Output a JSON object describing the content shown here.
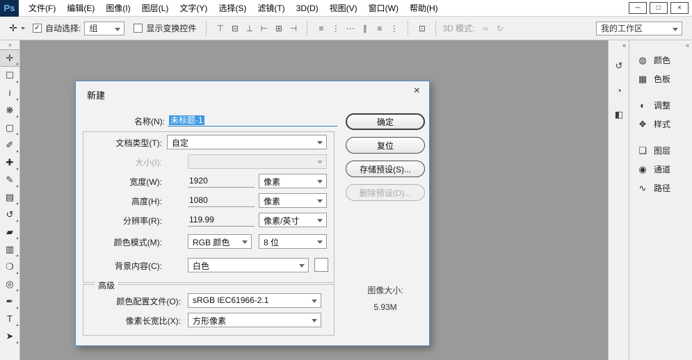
{
  "titlebar": {
    "logo": "Ps",
    "menus": [
      "文件(F)",
      "编辑(E)",
      "图像(I)",
      "图层(L)",
      "文字(Y)",
      "选择(S)",
      "滤镜(T)",
      "3D(D)",
      "视图(V)",
      "窗口(W)",
      "帮助(H)"
    ],
    "controls": {
      "minimize": "─",
      "maximize": "□",
      "close": "×"
    }
  },
  "options_bar": {
    "tool_icon": "✛",
    "auto_select": {
      "label": "自动选择:",
      "value": "组",
      "check_glyph": "✓"
    },
    "show_transform": {
      "label": "显示变换控件",
      "check_glyph": ""
    },
    "align_icons": [
      "⊤",
      "⊟",
      "⊥",
      "⊢",
      "⊞",
      "⊣",
      "≡",
      "⋮",
      "⋯",
      "∥",
      "≡",
      "⋮",
      "⊡"
    ],
    "mode3d": {
      "label": "3D 模式:",
      "icons": [
        "∞",
        "↻"
      ]
    },
    "workspace": {
      "value": "我的工作区"
    }
  },
  "toolbar": {
    "tools": [
      {
        "name": "move-tool",
        "glyph": "✛",
        "selected": true
      },
      {
        "name": "rectangular-marquee-tool",
        "glyph": "☐"
      },
      {
        "name": "lasso-tool",
        "glyph": "≀"
      },
      {
        "name": "quick-selection-tool",
        "glyph": "❋"
      },
      {
        "name": "crop-tool",
        "glyph": "▢"
      },
      {
        "name": "eyedropper-tool",
        "glyph": "✐"
      },
      {
        "name": "spot-healing-brush-tool",
        "glyph": "✚"
      },
      {
        "name": "brush-tool",
        "glyph": "✎"
      },
      {
        "name": "clone-stamp-tool",
        "glyph": "▤"
      },
      {
        "name": "history-brush-tool",
        "glyph": "↺"
      },
      {
        "name": "eraser-tool",
        "glyph": "▰"
      },
      {
        "name": "gradient-tool",
        "glyph": "▥"
      },
      {
        "name": "blur-tool",
        "glyph": "❍"
      },
      {
        "name": "dodge-tool",
        "glyph": "◎"
      },
      {
        "name": "pen-tool",
        "glyph": "✒"
      },
      {
        "name": "horizontal-type-tool",
        "glyph": "T"
      },
      {
        "name": "path-selection-tool",
        "glyph": "➤"
      }
    ]
  },
  "docks": {
    "collapse_left": "»",
    "collapse_right": "«",
    "icons": [
      {
        "name": "history-panel-icon",
        "glyph": "↺"
      },
      {
        "name": "properties-panel-icon",
        "glyph": "◔"
      },
      {
        "name": "clone-source-panel-icon",
        "glyph": "◧"
      }
    ]
  },
  "panels": {
    "groups": [
      [
        {
          "label": "颜色",
          "glyph": "◍"
        },
        {
          "label": "色板",
          "glyph": "▦"
        }
      ],
      [
        {
          "label": "调整",
          "glyph": "◐"
        },
        {
          "label": "样式",
          "glyph": "❖"
        }
      ],
      [
        {
          "label": "图层",
          "glyph": "❏"
        },
        {
          "label": "通道",
          "glyph": "◉"
        },
        {
          "label": "路径",
          "glyph": "∿"
        }
      ]
    ]
  },
  "dialog": {
    "title": "新建",
    "close_glyph": "×",
    "name": {
      "label": "名称(N):",
      "value": "未标题-1"
    },
    "doc_type": {
      "label": "文档类型(T):",
      "value": "自定"
    },
    "size": {
      "label": "大小(I):",
      "value": ""
    },
    "width": {
      "label": "宽度(W):",
      "value": "1920",
      "unit": "像素"
    },
    "height": {
      "label": "高度(H):",
      "value": "1080",
      "unit": "像素"
    },
    "resolution": {
      "label": "分辨率(R):",
      "value": "119.99",
      "unit": "像素/英寸"
    },
    "color_mode": {
      "label": "颜色模式(M):",
      "value": "RGB 颜色",
      "depth": "8 位"
    },
    "background": {
      "label": "背景内容(C):",
      "value": "白色"
    },
    "advanced": {
      "legend": "高级",
      "color_profile": {
        "label": "颜色配置文件(O):",
        "value": "sRGB IEC61966-2.1"
      },
      "pixel_aspect": {
        "label": "像素长宽比(X):",
        "value": "方形像素"
      }
    },
    "buttons": {
      "ok": "确定",
      "reset": "复位",
      "save_preset": "存储预设(S)...",
      "delete_preset": "删除预设(D)..."
    },
    "image_size": {
      "label": "图像大小:",
      "value": "5.93M"
    }
  },
  "colors": {
    "selection_blue": "#3d9ae4",
    "dialog_border": "#4f8fca",
    "canvas_gray": "#9a9a9a",
    "panel_bg": "#f0f0f0",
    "logo_bg": "#0d2c4f",
    "logo_text": "#6fb3f2"
  }
}
